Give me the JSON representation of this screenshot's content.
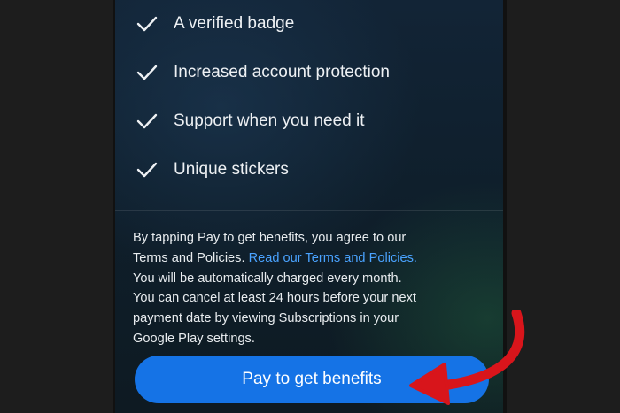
{
  "benefits": [
    {
      "label": "A verified badge",
      "icon": "checkmark-icon"
    },
    {
      "label": "Increased account protection",
      "icon": "checkmark-icon"
    },
    {
      "label": "Support when you need it",
      "icon": "checkmark-icon"
    },
    {
      "label": "Unique stickers",
      "icon": "checkmark-icon"
    }
  ],
  "legal": {
    "line1": "By tapping Pay to get benefits, you agree to our",
    "line2_prefix": "Terms and Policies. ",
    "line2_link": "Read our Terms and Policies.",
    "line3": "You will be automatically charged   every month.",
    "line4": "You can cancel at least 24 hours before your next",
    "line5": "payment date by viewing Subscriptions in your",
    "line6": "Google Play settings."
  },
  "pay_button": {
    "label": "Pay to get benefits"
  },
  "colors": {
    "button": "#1573e6",
    "link": "#4aa3ff",
    "arrow": "#d8151b",
    "text": "#eef1f4"
  }
}
